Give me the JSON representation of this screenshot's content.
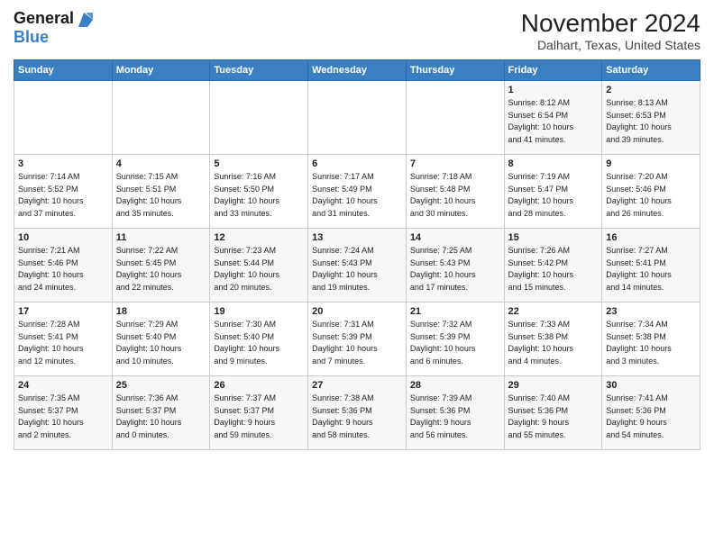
{
  "header": {
    "logo_line1": "General",
    "logo_line2": "Blue",
    "month_title": "November 2024",
    "location": "Dalhart, Texas, United States"
  },
  "days_of_week": [
    "Sunday",
    "Monday",
    "Tuesday",
    "Wednesday",
    "Thursday",
    "Friday",
    "Saturday"
  ],
  "weeks": [
    {
      "days": [
        {
          "num": "",
          "info": ""
        },
        {
          "num": "",
          "info": ""
        },
        {
          "num": "",
          "info": ""
        },
        {
          "num": "",
          "info": ""
        },
        {
          "num": "",
          "info": ""
        },
        {
          "num": "1",
          "info": "Sunrise: 8:12 AM\nSunset: 6:54 PM\nDaylight: 10 hours\nand 41 minutes."
        },
        {
          "num": "2",
          "info": "Sunrise: 8:13 AM\nSunset: 6:53 PM\nDaylight: 10 hours\nand 39 minutes."
        }
      ]
    },
    {
      "days": [
        {
          "num": "3",
          "info": "Sunrise: 7:14 AM\nSunset: 5:52 PM\nDaylight: 10 hours\nand 37 minutes."
        },
        {
          "num": "4",
          "info": "Sunrise: 7:15 AM\nSunset: 5:51 PM\nDaylight: 10 hours\nand 35 minutes."
        },
        {
          "num": "5",
          "info": "Sunrise: 7:16 AM\nSunset: 5:50 PM\nDaylight: 10 hours\nand 33 minutes."
        },
        {
          "num": "6",
          "info": "Sunrise: 7:17 AM\nSunset: 5:49 PM\nDaylight: 10 hours\nand 31 minutes."
        },
        {
          "num": "7",
          "info": "Sunrise: 7:18 AM\nSunset: 5:48 PM\nDaylight: 10 hours\nand 30 minutes."
        },
        {
          "num": "8",
          "info": "Sunrise: 7:19 AM\nSunset: 5:47 PM\nDaylight: 10 hours\nand 28 minutes."
        },
        {
          "num": "9",
          "info": "Sunrise: 7:20 AM\nSunset: 5:46 PM\nDaylight: 10 hours\nand 26 minutes."
        }
      ]
    },
    {
      "days": [
        {
          "num": "10",
          "info": "Sunrise: 7:21 AM\nSunset: 5:46 PM\nDaylight: 10 hours\nand 24 minutes."
        },
        {
          "num": "11",
          "info": "Sunrise: 7:22 AM\nSunset: 5:45 PM\nDaylight: 10 hours\nand 22 minutes."
        },
        {
          "num": "12",
          "info": "Sunrise: 7:23 AM\nSunset: 5:44 PM\nDaylight: 10 hours\nand 20 minutes."
        },
        {
          "num": "13",
          "info": "Sunrise: 7:24 AM\nSunset: 5:43 PM\nDaylight: 10 hours\nand 19 minutes."
        },
        {
          "num": "14",
          "info": "Sunrise: 7:25 AM\nSunset: 5:43 PM\nDaylight: 10 hours\nand 17 minutes."
        },
        {
          "num": "15",
          "info": "Sunrise: 7:26 AM\nSunset: 5:42 PM\nDaylight: 10 hours\nand 15 minutes."
        },
        {
          "num": "16",
          "info": "Sunrise: 7:27 AM\nSunset: 5:41 PM\nDaylight: 10 hours\nand 14 minutes."
        }
      ]
    },
    {
      "days": [
        {
          "num": "17",
          "info": "Sunrise: 7:28 AM\nSunset: 5:41 PM\nDaylight: 10 hours\nand 12 minutes."
        },
        {
          "num": "18",
          "info": "Sunrise: 7:29 AM\nSunset: 5:40 PM\nDaylight: 10 hours\nand 10 minutes."
        },
        {
          "num": "19",
          "info": "Sunrise: 7:30 AM\nSunset: 5:40 PM\nDaylight: 10 hours\nand 9 minutes."
        },
        {
          "num": "20",
          "info": "Sunrise: 7:31 AM\nSunset: 5:39 PM\nDaylight: 10 hours\nand 7 minutes."
        },
        {
          "num": "21",
          "info": "Sunrise: 7:32 AM\nSunset: 5:39 PM\nDaylight: 10 hours\nand 6 minutes."
        },
        {
          "num": "22",
          "info": "Sunrise: 7:33 AM\nSunset: 5:38 PM\nDaylight: 10 hours\nand 4 minutes."
        },
        {
          "num": "23",
          "info": "Sunrise: 7:34 AM\nSunset: 5:38 PM\nDaylight: 10 hours\nand 3 minutes."
        }
      ]
    },
    {
      "days": [
        {
          "num": "24",
          "info": "Sunrise: 7:35 AM\nSunset: 5:37 PM\nDaylight: 10 hours\nand 2 minutes."
        },
        {
          "num": "25",
          "info": "Sunrise: 7:36 AM\nSunset: 5:37 PM\nDaylight: 10 hours\nand 0 minutes."
        },
        {
          "num": "26",
          "info": "Sunrise: 7:37 AM\nSunset: 5:37 PM\nDaylight: 9 hours\nand 59 minutes."
        },
        {
          "num": "27",
          "info": "Sunrise: 7:38 AM\nSunset: 5:36 PM\nDaylight: 9 hours\nand 58 minutes."
        },
        {
          "num": "28",
          "info": "Sunrise: 7:39 AM\nSunset: 5:36 PM\nDaylight: 9 hours\nand 56 minutes."
        },
        {
          "num": "29",
          "info": "Sunrise: 7:40 AM\nSunset: 5:36 PM\nDaylight: 9 hours\nand 55 minutes."
        },
        {
          "num": "30",
          "info": "Sunrise: 7:41 AM\nSunset: 5:36 PM\nDaylight: 9 hours\nand 54 minutes."
        }
      ]
    }
  ]
}
